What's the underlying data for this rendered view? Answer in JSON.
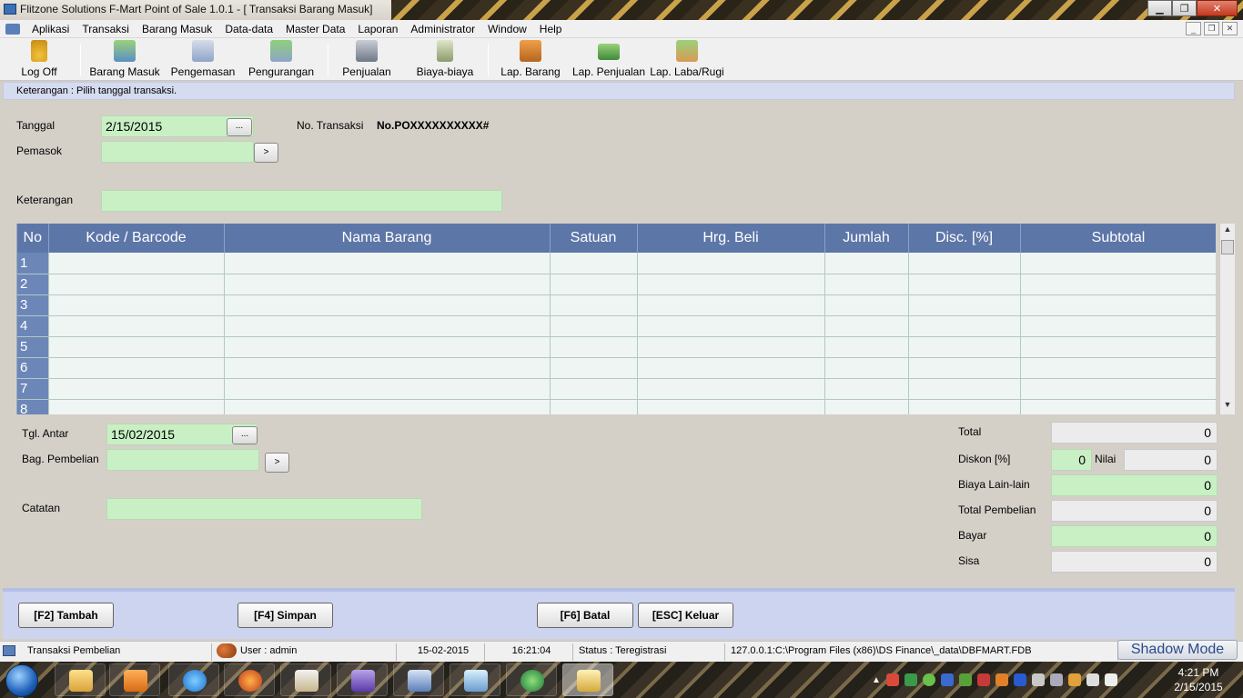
{
  "window": {
    "title": "Flitzone Solutions F-Mart Point of Sale 1.0.1      - [ Transaksi Barang Masuk]"
  },
  "menu": [
    "Aplikasi",
    "Transaksi",
    "Barang Masuk",
    "Data-data",
    "Master Data",
    "Laporan",
    "Administrator",
    "Window",
    "Help"
  ],
  "toolbar": {
    "logoff": "Log Off",
    "barang_masuk": "Barang Masuk",
    "pengemasan": "Pengemasan",
    "pengurangan": "Pengurangan",
    "penjualan": "Penjualan",
    "biaya": "Biaya-biaya",
    "lap_barang": "Lap. Barang",
    "lap_penjualan": "Lap. Penjualan",
    "lap_labarugi": "Lap. Laba/Rugi"
  },
  "info": "Keterangan : Pilih tanggal transaksi.",
  "header_form": {
    "tanggal_label": "Tanggal",
    "tanggal_value": "2/15/2015",
    "pemasok_label": "Pemasok",
    "pemasok_value": "",
    "no_transaksi_label": "No. Transaksi",
    "no_transaksi_value": "No.POXXXXXXXXXX#",
    "keterangan_label": "Keterangan",
    "keterangan_value": "",
    "dots": "...",
    "arrow": ">"
  },
  "grid": {
    "columns": [
      "No",
      "Kode / Barcode",
      "Nama Barang",
      "Satuan",
      "Hrg. Beli",
      "Jumlah",
      "Disc. [%]",
      "Subtotal"
    ],
    "rows": [
      "1",
      "2",
      "3",
      "4",
      "5",
      "6",
      "7",
      "8"
    ]
  },
  "footer_form": {
    "tgl_antar_label": "Tgl. Antar",
    "tgl_antar_value": "15/02/2015",
    "bag_pembelian_label": "Bag. Pembelian",
    "bag_pembelian_value": "",
    "catatan_label": "Catatan",
    "catatan_value": ""
  },
  "totals": {
    "total_label": "Total",
    "total_value": "0",
    "diskon_label": "Diskon [%]",
    "diskon_value": "0",
    "nilai_label": "Nilai",
    "nilai_value": "0",
    "biaya_label": "Biaya Lain-lain",
    "biaya_value": "0",
    "total_pembelian_label": "Total Pembelian",
    "total_pembelian_value": "0",
    "bayar_label": "Bayar",
    "bayar_value": "0",
    "sisa_label": "Sisa",
    "sisa_value": "0"
  },
  "buttons": {
    "tambah": "[F2] Tambah",
    "simpan": "[F4] Simpan",
    "batal": "[F6] Batal",
    "keluar": "[ESC] Keluar"
  },
  "status": {
    "module": "Transaksi Pembelian",
    "user": "User : admin",
    "date": "15-02-2015",
    "time": "16:21:04",
    "reg": "Status : Teregistrasi",
    "db": "127.0.0.1:C:\\Program Files (x86)\\DS Finance\\_data\\DBFMART.FDB",
    "shadow": "Shadow Mode"
  },
  "taskbar": {
    "time": "4:21 PM",
    "date": "2/15/2015"
  },
  "colors": {
    "grid_header": "#5d76a8",
    "field_green": "#c8f0c4",
    "info_strip": "#d6dcef"
  }
}
